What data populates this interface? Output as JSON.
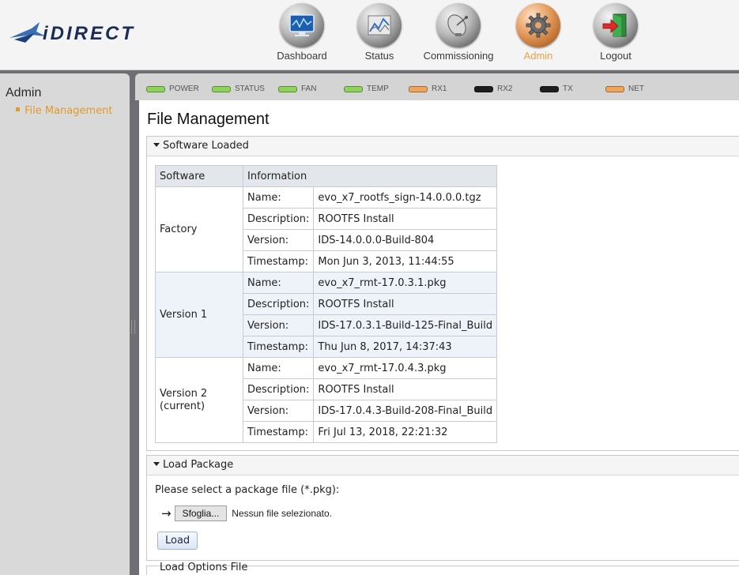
{
  "brand": {
    "logo_text": "iDirect"
  },
  "nav": [
    {
      "label": "Dashboard",
      "icon": "dashboard-monitor-icon",
      "active": false
    },
    {
      "label": "Status",
      "icon": "status-graph-icon",
      "active": false
    },
    {
      "label": "Commissioning",
      "icon": "satellite-dish-icon",
      "active": false
    },
    {
      "label": "Admin",
      "icon": "gear-icon",
      "active": true
    },
    {
      "label": "Logout",
      "icon": "logout-door-icon",
      "active": false
    }
  ],
  "sidebar": {
    "title": "Admin",
    "items": [
      {
        "label": "File Management",
        "active": true
      }
    ]
  },
  "status_leds": [
    {
      "label": "POWER",
      "color": "#8fd35a"
    },
    {
      "label": "STATUS",
      "color": "#8fd35a"
    },
    {
      "label": "FAN",
      "color": "#8fd35a"
    },
    {
      "label": "TEMP",
      "color": "#8fd35a"
    },
    {
      "label": "RX1",
      "color": "#f0a55a"
    },
    {
      "label": "RX2",
      "color": "#1e1e1e"
    },
    {
      "label": "TX",
      "color": "#1e1e1e"
    },
    {
      "label": "NET",
      "color": "#f0a55a"
    }
  ],
  "page": {
    "title": "File Management"
  },
  "software_loaded": {
    "heading": "Software Loaded",
    "columns": [
      "Software",
      "Information"
    ],
    "field_labels": [
      "Name:",
      "Description:",
      "Version:",
      "Timestamp:"
    ],
    "groups": [
      {
        "name": "Factory",
        "values": [
          "evo_x7_rootfs_sign-14.0.0.0.tgz",
          "ROOTFS Install",
          "IDS-14.0.0.0-Build-804",
          "Mon Jun 3, 2013, 11:44:55"
        ]
      },
      {
        "name": "Version 1",
        "values": [
          "evo_x7_rmt-17.0.3.1.pkg",
          "ROOTFS Install",
          "IDS-17.0.3.1-Build-125-Final_Build",
          "Thu Jun 8, 2017, 14:37:43"
        ]
      },
      {
        "name": "Version 2",
        "name_sub": "(current)",
        "values": [
          "evo_x7_rmt-17.0.4.3.pkg",
          "ROOTFS Install",
          "IDS-17.0.4.3-Build-208-Final_Build",
          "Fri Jul 13, 2018, 22:21:32"
        ]
      }
    ]
  },
  "load_package": {
    "heading": "Load Package",
    "prompt": "Please select a package file (*.pkg):",
    "arrow": "→",
    "browse_label": "Sfoglia...",
    "no_file_text": "Nessun file selezionato.",
    "load_label": "Load"
  },
  "next_panel": {
    "heading_partial": "Load Options File"
  }
}
